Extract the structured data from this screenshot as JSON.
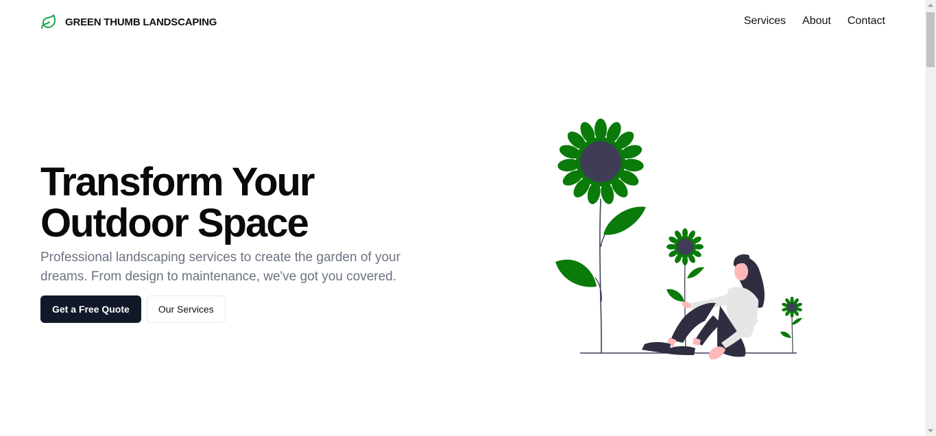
{
  "brand": {
    "name": "GREEN THUMB LANDSCAPING",
    "icon": "leaf-icon",
    "color": "#16a34a"
  },
  "nav": {
    "items": [
      "Services",
      "About",
      "Contact"
    ]
  },
  "hero": {
    "title_line1": "Transform Your",
    "title_line2": "Outdoor Space",
    "subtitle": "Professional landscaping services to create the garden of your dreams. From design to maintenance, we've got you covered.",
    "primary_button": "Get a Free Quote",
    "secondary_button": "Our Services"
  },
  "illustration": {
    "name": "woman-with-sunflowers-illustration",
    "colors": {
      "leaf": "#0a7a0a",
      "flower_center": "#3f3d56",
      "hair": "#2f2e41",
      "skin": "#ffb8b8",
      "shirt": "#e6e6e6"
    }
  },
  "colors": {
    "primary_button_bg": "#111827",
    "subtitle_text": "#6b7280"
  }
}
